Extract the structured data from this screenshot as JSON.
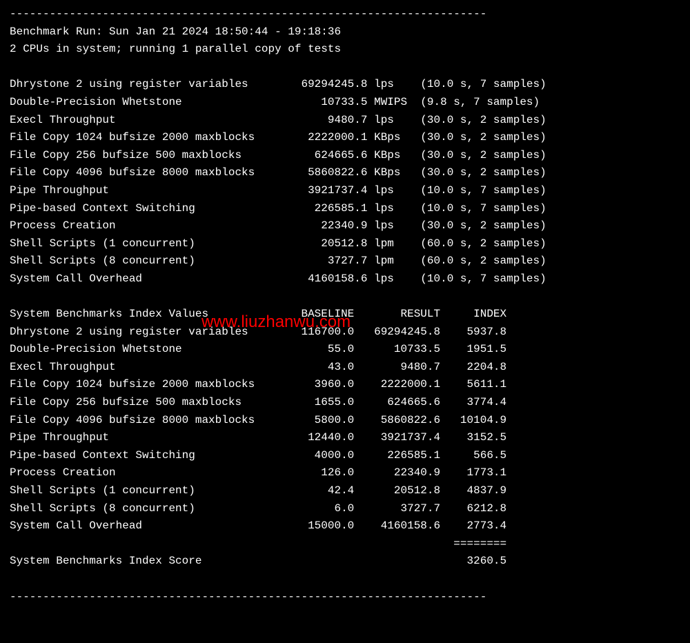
{
  "watermark": "www.liuzhanwu.com",
  "separator_top": "------------------------------------------------------------------------",
  "header": {
    "run_line": "Benchmark Run: Sun Jan 21 2024 18:50:44 - 19:18:36",
    "cpu_line": "2 CPUs in system; running 1 parallel copy of tests"
  },
  "tests": [
    {
      "name": "Dhrystone 2 using register variables",
      "value": "69294245.8",
      "unit": "lps",
      "timing": "(10.0 s, 7 samples)"
    },
    {
      "name": "Double-Precision Whetstone",
      "value": "10733.5",
      "unit": "MWIPS",
      "timing": "(9.8 s, 7 samples)"
    },
    {
      "name": "Execl Throughput",
      "value": "9480.7",
      "unit": "lps",
      "timing": "(30.0 s, 2 samples)"
    },
    {
      "name": "File Copy 1024 bufsize 2000 maxblocks",
      "value": "2222000.1",
      "unit": "KBps",
      "timing": "(30.0 s, 2 samples)"
    },
    {
      "name": "File Copy 256 bufsize 500 maxblocks",
      "value": "624665.6",
      "unit": "KBps",
      "timing": "(30.0 s, 2 samples)"
    },
    {
      "name": "File Copy 4096 bufsize 8000 maxblocks",
      "value": "5860822.6",
      "unit": "KBps",
      "timing": "(30.0 s, 2 samples)"
    },
    {
      "name": "Pipe Throughput",
      "value": "3921737.4",
      "unit": "lps",
      "timing": "(10.0 s, 7 samples)"
    },
    {
      "name": "Pipe-based Context Switching",
      "value": "226585.1",
      "unit": "lps",
      "timing": "(10.0 s, 7 samples)"
    },
    {
      "name": "Process Creation",
      "value": "22340.9",
      "unit": "lps",
      "timing": "(30.0 s, 2 samples)"
    },
    {
      "name": "Shell Scripts (1 concurrent)",
      "value": "20512.8",
      "unit": "lpm",
      "timing": "(60.0 s, 2 samples)"
    },
    {
      "name": "Shell Scripts (8 concurrent)",
      "value": "3727.7",
      "unit": "lpm",
      "timing": "(60.0 s, 2 samples)"
    },
    {
      "name": "System Call Overhead",
      "value": "4160158.6",
      "unit": "lps",
      "timing": "(10.0 s, 7 samples)"
    }
  ],
  "index_header": {
    "title": "System Benchmarks Index Values",
    "col_baseline": "BASELINE",
    "col_result": "RESULT",
    "col_index": "INDEX"
  },
  "index_rows": [
    {
      "name": "Dhrystone 2 using register variables",
      "baseline": "116700.0",
      "result": "69294245.8",
      "index": "5937.8"
    },
    {
      "name": "Double-Precision Whetstone",
      "baseline": "55.0",
      "result": "10733.5",
      "index": "1951.5"
    },
    {
      "name": "Execl Throughput",
      "baseline": "43.0",
      "result": "9480.7",
      "index": "2204.8"
    },
    {
      "name": "File Copy 1024 bufsize 2000 maxblocks",
      "baseline": "3960.0",
      "result": "2222000.1",
      "index": "5611.1"
    },
    {
      "name": "File Copy 256 bufsize 500 maxblocks",
      "baseline": "1655.0",
      "result": "624665.6",
      "index": "3774.4"
    },
    {
      "name": "File Copy 4096 bufsize 8000 maxblocks",
      "baseline": "5800.0",
      "result": "5860822.6",
      "index": "10104.9"
    },
    {
      "name": "Pipe Throughput",
      "baseline": "12440.0",
      "result": "3921737.4",
      "index": "3152.5"
    },
    {
      "name": "Pipe-based Context Switching",
      "baseline": "4000.0",
      "result": "226585.1",
      "index": "566.5"
    },
    {
      "name": "Process Creation",
      "baseline": "126.0",
      "result": "22340.9",
      "index": "1773.1"
    },
    {
      "name": "Shell Scripts (1 concurrent)",
      "baseline": "42.4",
      "result": "20512.8",
      "index": "4837.9"
    },
    {
      "name": "Shell Scripts (8 concurrent)",
      "baseline": "6.0",
      "result": "3727.7",
      "index": "6212.8"
    },
    {
      "name": "System Call Overhead",
      "baseline": "15000.0",
      "result": "4160158.6",
      "index": "2773.4"
    }
  ],
  "index_divider": "========",
  "score": {
    "label": "System Benchmarks Index Score",
    "value": "3260.5"
  },
  "separator_bottom": "------------------------------------------------------------------------"
}
